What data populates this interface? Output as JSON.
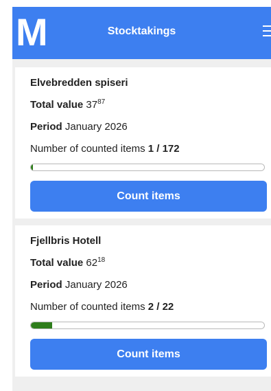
{
  "header": {
    "logo": "M",
    "title": "Stocktakings"
  },
  "stocktakings": [
    {
      "name": "Elvebredden spiseri",
      "total_value_label": "Total value",
      "total_value_main": "37",
      "total_value_decimals": "87",
      "period_label": "Period",
      "period_value": "January 2026",
      "counted_label": "Number of counted items",
      "counted_value": "1 / 172",
      "progress_fraction": 0.006,
      "button_label": "Count items"
    },
    {
      "name": "Fjellbris Hotell",
      "total_value_label": "Total value",
      "total_value_main": "62",
      "total_value_decimals": "18",
      "period_label": "Period",
      "period_value": "January 2026",
      "counted_label": "Number of counted items",
      "counted_value": "2 / 22",
      "progress_fraction": 0.09,
      "button_label": "Count items"
    }
  ],
  "colors": {
    "primary": "#3d7ff0",
    "progress": "#2e7d1b"
  },
  "icons": {
    "menu": "hamburger-menu-icon"
  }
}
